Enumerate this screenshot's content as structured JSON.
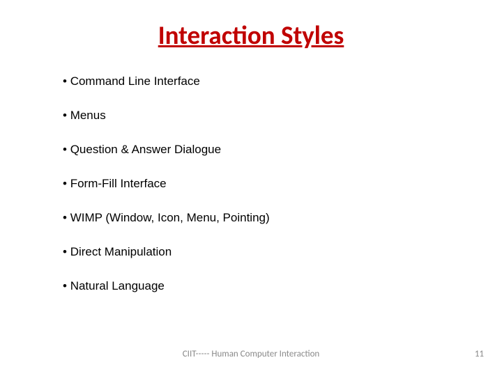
{
  "slide": {
    "title": "Interaction Styles",
    "bullets": [
      "Command Line Interface",
      "Menus",
      "Question & Answer Dialogue",
      "Form-Fill Interface",
      "WIMP (Window, Icon, Menu, Pointing)",
      "Direct Manipulation",
      "Natural Language"
    ],
    "footer": "CIIT----- Human Computer Interaction",
    "page_number": "11"
  }
}
